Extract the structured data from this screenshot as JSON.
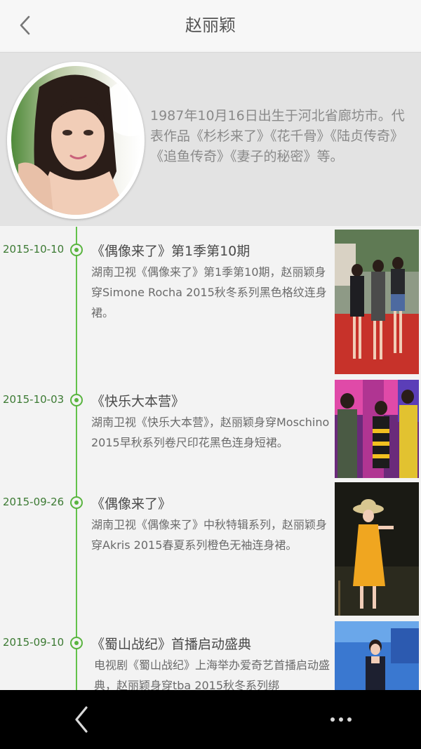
{
  "header": {
    "title": "赵丽颖",
    "back_icon": "chevron-left-icon"
  },
  "profile": {
    "bio": "1987年10月16日出生于河北省廊坊市。代表作品《杉杉来了》《花千骨》《陆贞传奇》《追鱼传奇》《妻子的秘密》等。"
  },
  "timeline": {
    "accent_color": "#62c24a",
    "entries": [
      {
        "date": "2015-10-10",
        "title": "《偶像来了》第1季第10期",
        "description": "湖南卫视《偶像来了》第1季第10期，赵丽颖身穿Simone Rocha 2015秋冬系列黑色格纹连身裙。"
      },
      {
        "date": "2015-10-03",
        "title": "《快乐大本营》",
        "description": "湖南卫视《快乐大本营》，赵丽颖身穿Moschino 2015早秋系列卷尺印花黑色连身短裙。"
      },
      {
        "date": "2015-09-26",
        "title": "《偶像来了》",
        "description": "湖南卫视《偶像来了》中秋特辑系列，赵丽颖身穿Akris 2015春夏系列橙色无袖连身裙。"
      },
      {
        "date": "2015-09-10",
        "title": "《蜀山战纪》首播启动盛典",
        "description": "电视剧《蜀山战纪》上海举办爱奇艺首播启动盛典，赵丽颖身穿tba 2015秋冬系列绑"
      }
    ]
  },
  "navbar": {
    "back_icon": "chevron-left-icon",
    "more_icon": "more-dots-icon"
  }
}
